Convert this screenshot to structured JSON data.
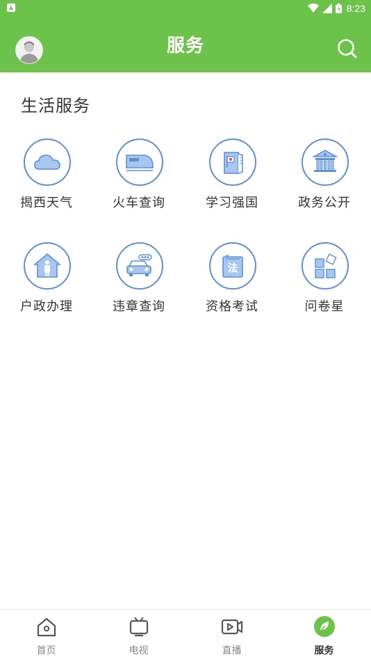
{
  "status_bar": {
    "time": "8:23"
  },
  "header": {
    "title": "服务"
  },
  "section": {
    "title": "生活服务"
  },
  "services": [
    {
      "label": "揭西天气",
      "icon": "cloud-icon"
    },
    {
      "label": "火车查询",
      "icon": "train-icon"
    },
    {
      "label": "学习强国",
      "icon": "book-flag-icon"
    },
    {
      "label": "政务公开",
      "icon": "government-building-icon"
    },
    {
      "label": "户政办理",
      "icon": "house-person-icon"
    },
    {
      "label": "违章查询",
      "icon": "car-icon"
    },
    {
      "label": "资格考试",
      "icon": "law-book-icon"
    },
    {
      "label": "问卷星",
      "icon": "app-grid-icon"
    }
  ],
  "bottom_nav": [
    {
      "label": "首页",
      "icon": "home-icon",
      "active": false
    },
    {
      "label": "电视",
      "icon": "tv-icon",
      "active": false
    },
    {
      "label": "直播",
      "icon": "live-video-icon",
      "active": false
    },
    {
      "label": "服务",
      "icon": "leaf-icon",
      "active": true
    }
  ],
  "colors": {
    "brand_green": "#6cc24a",
    "icon_blue": "#5b8fd6",
    "icon_fill": "#a9c6f0"
  }
}
